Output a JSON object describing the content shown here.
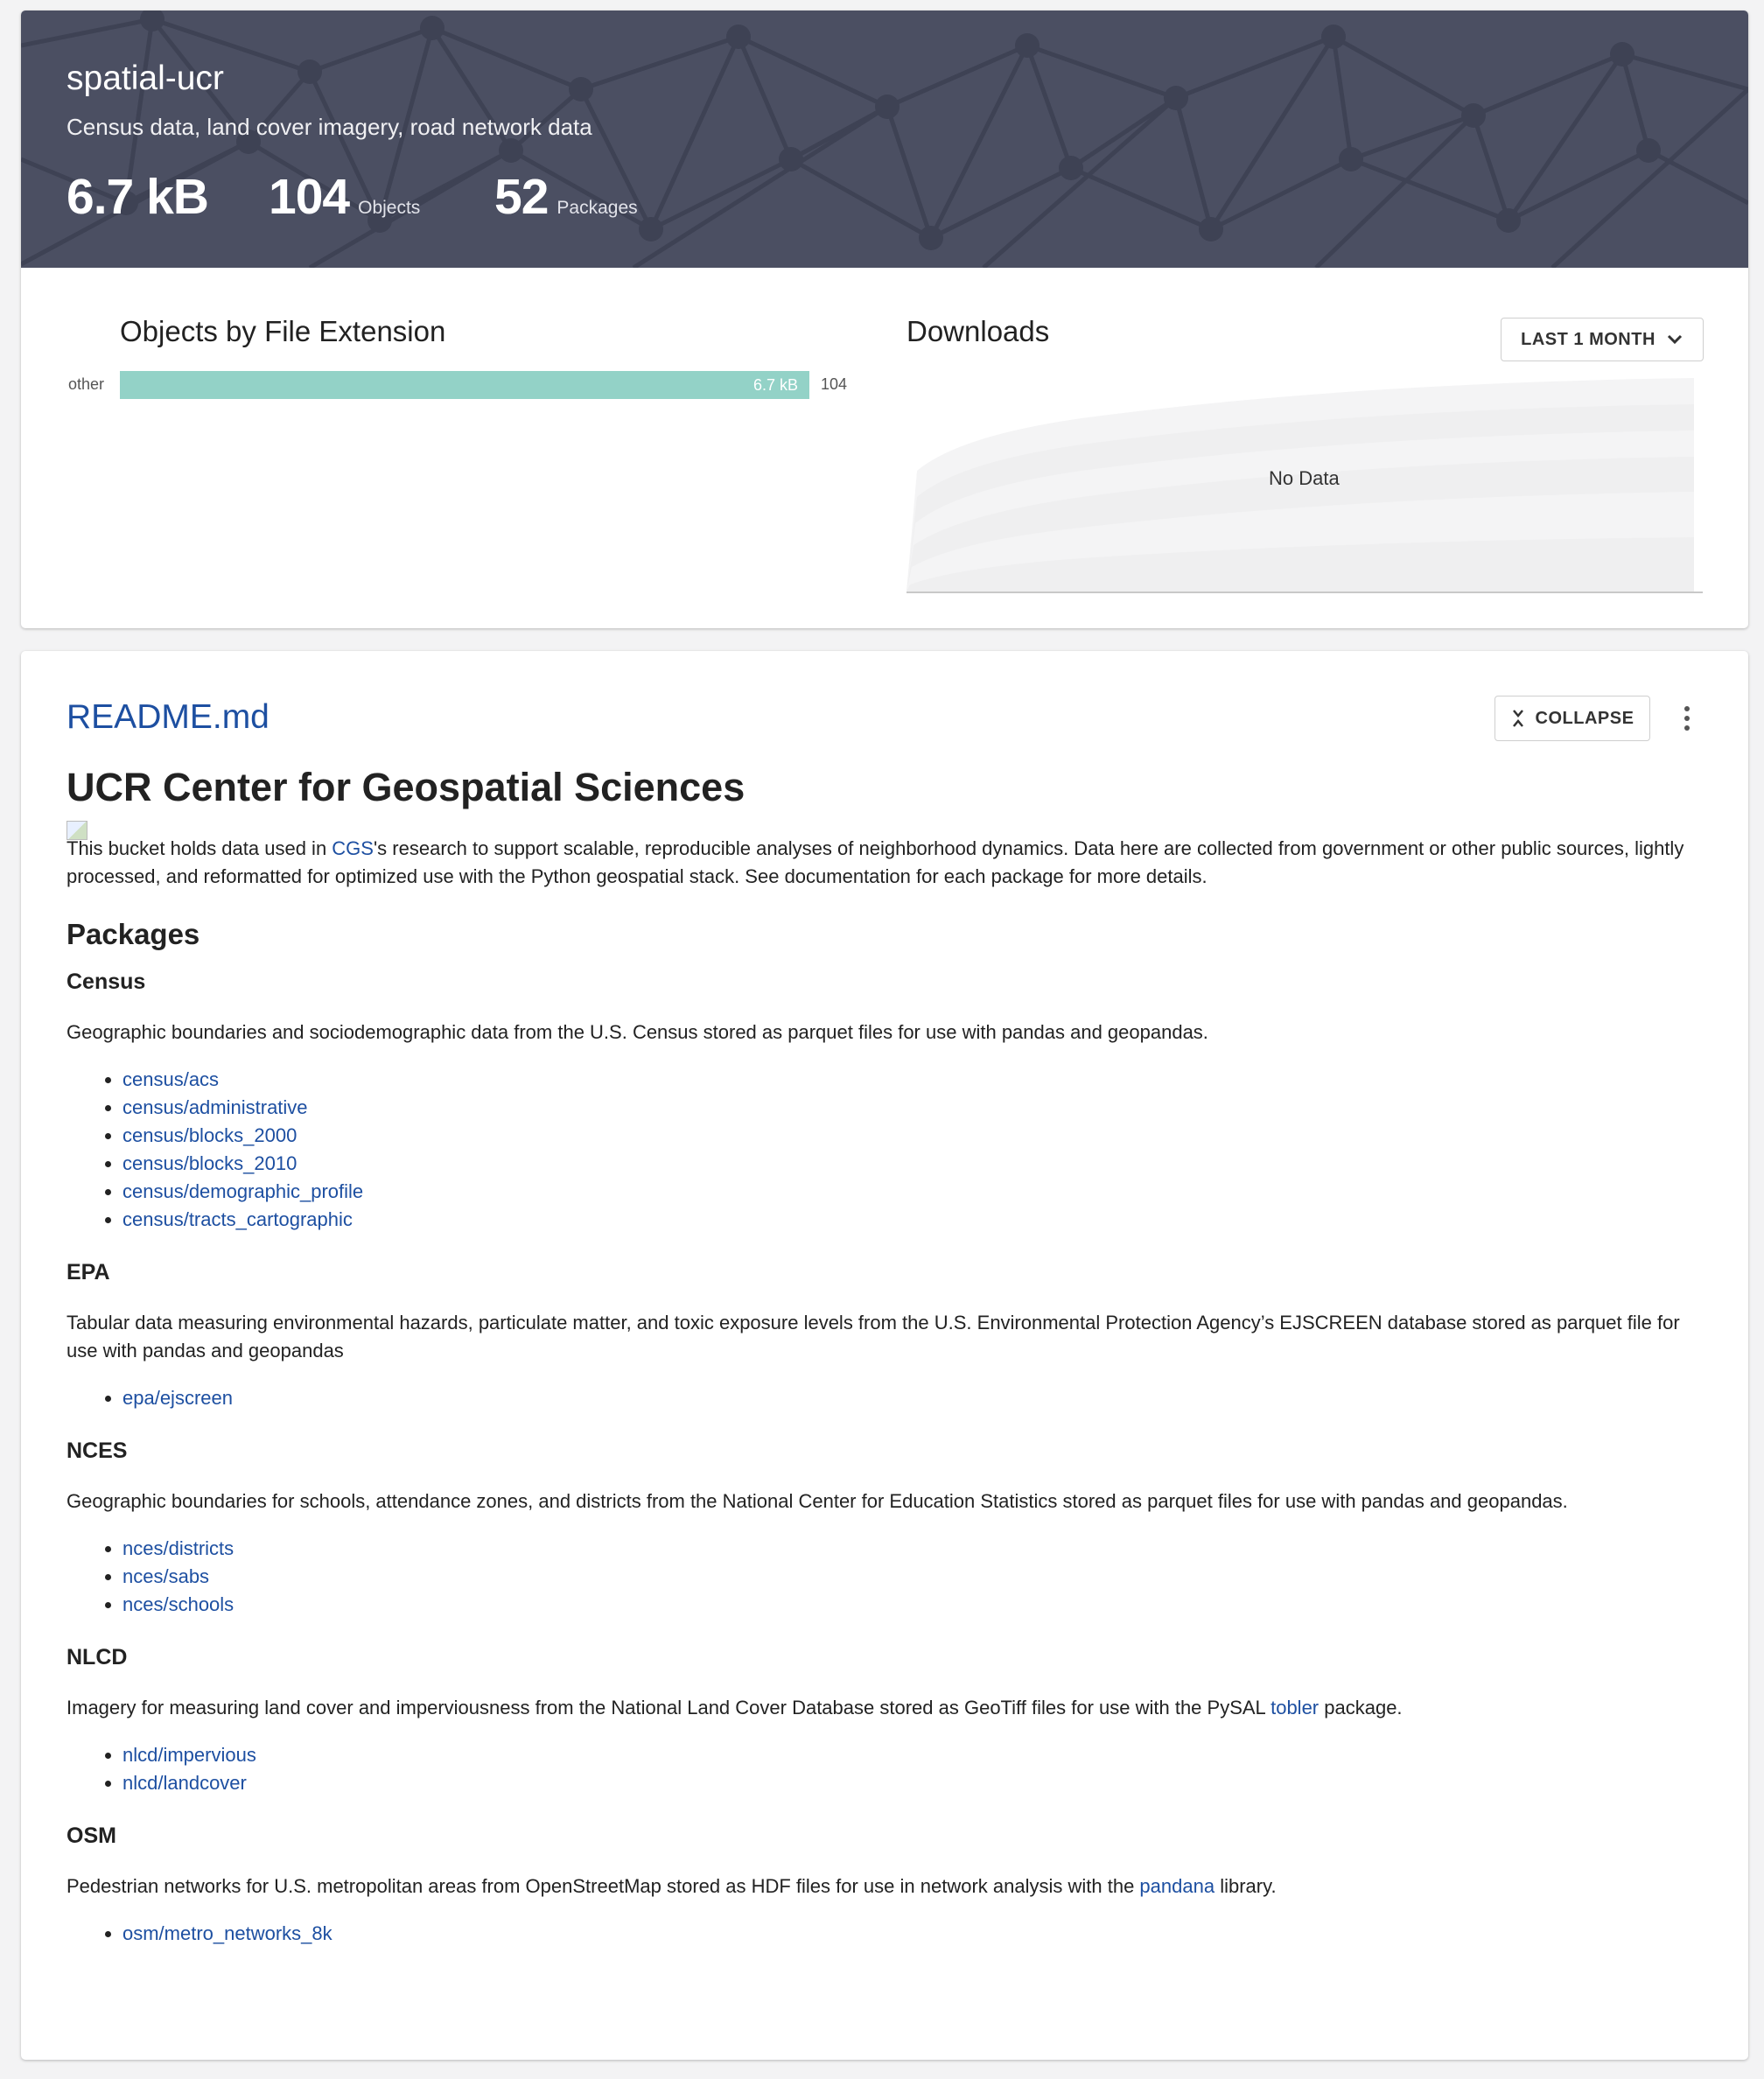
{
  "bucket": {
    "name": "spatial-ucr",
    "description": "Census data, land cover imagery, road network data",
    "size": "6.7 kB",
    "objects_count": "104",
    "objects_label": "Objects",
    "packages_count": "52",
    "packages_label": "Packages"
  },
  "extensions_panel": {
    "title": "Objects by File Extension",
    "chart_data": {
      "type": "bar",
      "orientation": "horizontal",
      "categories": [
        "other"
      ],
      "size_labels": [
        "6.7 kB"
      ],
      "values": [
        104
      ]
    }
  },
  "downloads_panel": {
    "title": "Downloads",
    "range_label": "LAST 1 MONTH",
    "empty_label": "No Data"
  },
  "readme": {
    "file_name": "README.md",
    "collapse_label": "COLLAPSE",
    "heading": "UCR Center for Geospatial Sciences",
    "intro_before_link": "This bucket holds data used in ",
    "intro_link": "CGS",
    "intro_after_link": "'s research to support scalable, reproducible analyses of neighborhood dynamics. Data here are collected from government or other public sources, lightly processed, and reformatted for optimized use with the Python geospatial stack. See documentation for each package for more details.",
    "packages_heading": "Packages",
    "sections": {
      "census": {
        "title": "Census",
        "description": "Geographic boundaries and sociodemographic data from the U.S. Census stored as parquet files for use with pandas and geopandas.",
        "links": [
          "census/acs",
          "census/administrative",
          "census/blocks_2000",
          "census/blocks_2010",
          "census/demographic_profile",
          "census/tracts_cartographic"
        ]
      },
      "epa": {
        "title": "EPA",
        "description": "Tabular data measuring environmental hazards, particulate matter, and toxic exposure levels from the U.S. Environmental Protection Agency’s EJSCREEN database stored as parquet file for use with pandas and geopandas",
        "links": [
          "epa/ejscreen"
        ]
      },
      "nces": {
        "title": "NCES",
        "description": "Geographic boundaries for schools, attendance zones, and districts from the National Center for Education Statistics stored as parquet files for use with pandas and geopandas.",
        "links": [
          "nces/districts",
          "nces/sabs",
          "nces/schools"
        ]
      },
      "nlcd": {
        "title": "NLCD",
        "description_before_link": "Imagery for measuring land cover and imperviousness from the National Land Cover Database stored as GeoTiff files for use with the PySAL ",
        "description_link": "tobler",
        "description_after_link": " package.",
        "links": [
          "nlcd/impervious",
          "nlcd/landcover"
        ]
      },
      "osm": {
        "title": "OSM",
        "description_before_link": "Pedestrian networks for U.S. metropolitan areas from OpenStreetMap stored as HDF files for use in network analysis with the ",
        "description_link": "pandana",
        "description_after_link": " library.",
        "links": [
          "osm/metro_networks_8k"
        ]
      }
    }
  },
  "colors": {
    "hero_bg": "#4b4f62",
    "bar_fill": "#93d2c7",
    "link": "#1d4fa1"
  }
}
